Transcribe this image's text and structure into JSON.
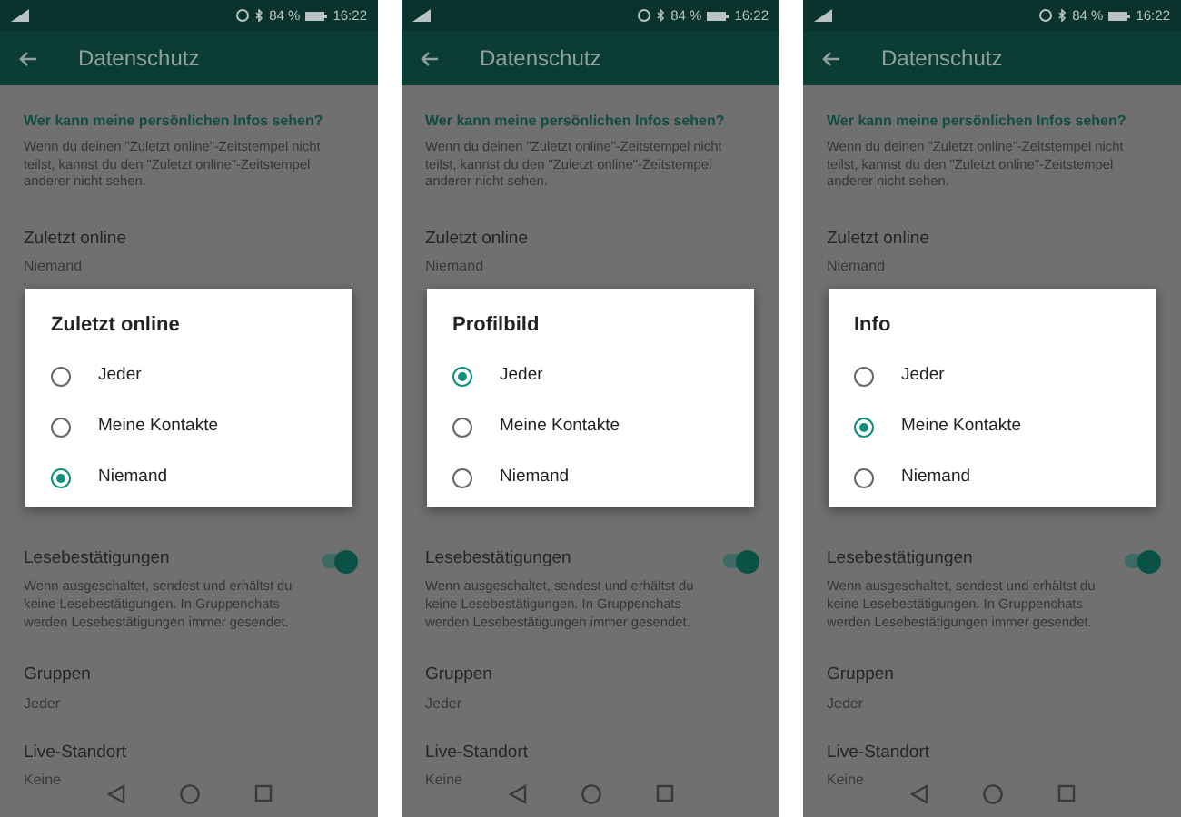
{
  "screens": [
    {
      "status_bar": {
        "battery": "84 %",
        "time": "16:22"
      },
      "title": "Datenschutz",
      "section_heading": "Wer kann meine persönlichen Infos sehen?",
      "description": "Wenn du deinen \"Zuletzt online\"-Zeitstempel nicht teilst, kannst du den \"Zuletzt online\"-Zeitstempel anderer nicht sehen.",
      "top_setting": {
        "label": "Zuletzt online",
        "value": "Niemand"
      },
      "dialog": {
        "title": "Zuletzt online",
        "options": [
          {
            "label": "Jeder",
            "selected": false
          },
          {
            "label": "Meine Kontakte",
            "selected": false
          },
          {
            "label": "Niemand",
            "selected": true
          }
        ]
      },
      "read_receipts": {
        "label": "Lesebestätigungen",
        "description": "Wenn ausgeschaltet, sendest und erhältst du keine Lesebestätigungen. In Gruppenchats werden Lesebestätigungen immer gesendet.",
        "on": true
      },
      "settings": [
        {
          "label": "Gruppen",
          "value": "Jeder"
        },
        {
          "label": "Live-Standort",
          "value": "Keine"
        }
      ]
    },
    {
      "status_bar": {
        "battery": "84 %",
        "time": "16:22"
      },
      "title": "Datenschutz",
      "section_heading": "Wer kann meine persönlichen Infos sehen?",
      "description": "Wenn du deinen \"Zuletzt online\"-Zeitstempel nicht teilst, kannst du den \"Zuletzt online\"-Zeitstempel anderer nicht sehen.",
      "top_setting": {
        "label": "Zuletzt online",
        "value": "Niemand"
      },
      "dialog": {
        "title": "Profilbild",
        "options": [
          {
            "label": "Jeder",
            "selected": true
          },
          {
            "label": "Meine Kontakte",
            "selected": false
          },
          {
            "label": "Niemand",
            "selected": false
          }
        ]
      },
      "read_receipts": {
        "label": "Lesebestätigungen",
        "description": "Wenn ausgeschaltet, sendest und erhältst du keine Lesebestätigungen. In Gruppenchats werden Lesebestätigungen immer gesendet.",
        "on": true
      },
      "settings": [
        {
          "label": "Gruppen",
          "value": "Jeder"
        },
        {
          "label": "Live-Standort",
          "value": "Keine"
        }
      ]
    },
    {
      "status_bar": {
        "battery": "84 %",
        "time": "16:22"
      },
      "title": "Datenschutz",
      "section_heading": "Wer kann meine persönlichen Infos sehen?",
      "description": "Wenn du deinen \"Zuletzt online\"-Zeitstempel nicht teilst, kannst du den \"Zuletzt online\"-Zeitstempel anderer nicht sehen.",
      "top_setting": {
        "label": "Zuletzt online",
        "value": "Niemand"
      },
      "dialog": {
        "title": "Info",
        "options": [
          {
            "label": "Jeder",
            "selected": false
          },
          {
            "label": "Meine Kontakte",
            "selected": true
          },
          {
            "label": "Niemand",
            "selected": false
          }
        ]
      },
      "read_receipts": {
        "label": "Lesebestätigungen",
        "description": "Wenn ausgeschaltet, sendest und erhältst du keine Lesebestätigungen. In Gruppenchats werden Lesebestätigungen immer gesendet.",
        "on": true
      },
      "settings": [
        {
          "label": "Gruppen",
          "value": "Jeder"
        },
        {
          "label": "Live-Standort",
          "value": "Keine"
        }
      ]
    }
  ]
}
